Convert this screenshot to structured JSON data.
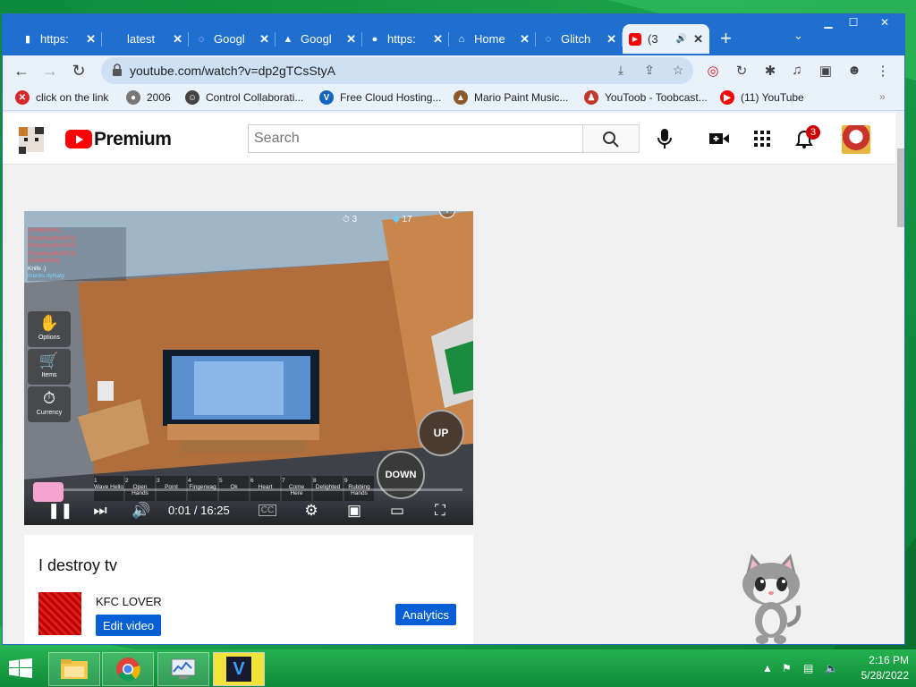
{
  "browser": {
    "tabs": [
      {
        "title": "https:",
        "icon": "doc-icon"
      },
      {
        "title": "latest",
        "icon": "blank-icon"
      },
      {
        "title": "Googl",
        "icon": "loading-icon"
      },
      {
        "title": "Googl",
        "icon": "drive-icon"
      },
      {
        "title": "https:",
        "icon": "globe-icon"
      },
      {
        "title": "Home",
        "icon": "home-icon"
      },
      {
        "title": "Glitch",
        "icon": "loading-icon"
      },
      {
        "title": "(3",
        "icon": "youtube-icon",
        "active": true
      }
    ],
    "url": "youtube.com/watch?v=dp2gTCsStyA",
    "bookmarks": [
      {
        "label": "click on the link",
        "color": "#d62a2a",
        "glyph": "✕"
      },
      {
        "label": "2006",
        "color": "#777777",
        "glyph": "●"
      },
      {
        "label": "Control Collaborati...",
        "color": "#444444",
        "glyph": "☺"
      },
      {
        "label": "Free Cloud Hosting...",
        "color": "#1565c0",
        "glyph": "V"
      },
      {
        "label": "Mario Paint Music...",
        "color": "#8a5a2b",
        "glyph": "▲"
      },
      {
        "label": "YouToob - Toobcast...",
        "color": "#c0392b",
        "glyph": "♟"
      },
      {
        "label": "(11) YouTube",
        "color": "#ff0000",
        "glyph": "▶"
      }
    ]
  },
  "youtube": {
    "logo": "Premium",
    "search_placeholder": "Search",
    "notification_count": "3",
    "video": {
      "title": "I destroy tv",
      "time": "0:01 / 16:25",
      "progress_fraction": 0.001,
      "game_hud": {
        "timer": "3",
        "gems": "17",
        "buttons": [
          "Options",
          "Items",
          "Currency"
        ],
        "move_up": "UP",
        "move_down": "DOWN",
        "emotes": [
          "Wave Hello",
          "Open Hands",
          "Point",
          "Fingerwag",
          "Ok",
          "Heart",
          "Come Here",
          "Delighted",
          "Rubbing Hands"
        ]
      },
      "chat": [
        {
          "name": "[ylrbdk5hoh]:",
          "color": "#ff5b5b"
        },
        {
          "name": "[froyadsyafie2021]:",
          "color": "#ff5b5b"
        },
        {
          "name": "[froyadsyafie2022]:",
          "color": "#ff5b5b"
        },
        {
          "name": "[froyadsyafie2021]:",
          "color": "#ff5b5b"
        },
        {
          "name": "[ylrbdk5hoh]:",
          "color": "#ff5b5b"
        },
        {
          "name": "Knife :)",
          "color": "#ffffff"
        },
        {
          "name": "thanks dyNaty",
          "color": "#7fd3ff"
        }
      ]
    },
    "channel": {
      "name": "KFC LOVER",
      "edit_label": "Edit video",
      "analytics_label": "Analytics"
    }
  },
  "taskbar": {
    "time": "2:16 PM",
    "date": "5/28/2022"
  }
}
